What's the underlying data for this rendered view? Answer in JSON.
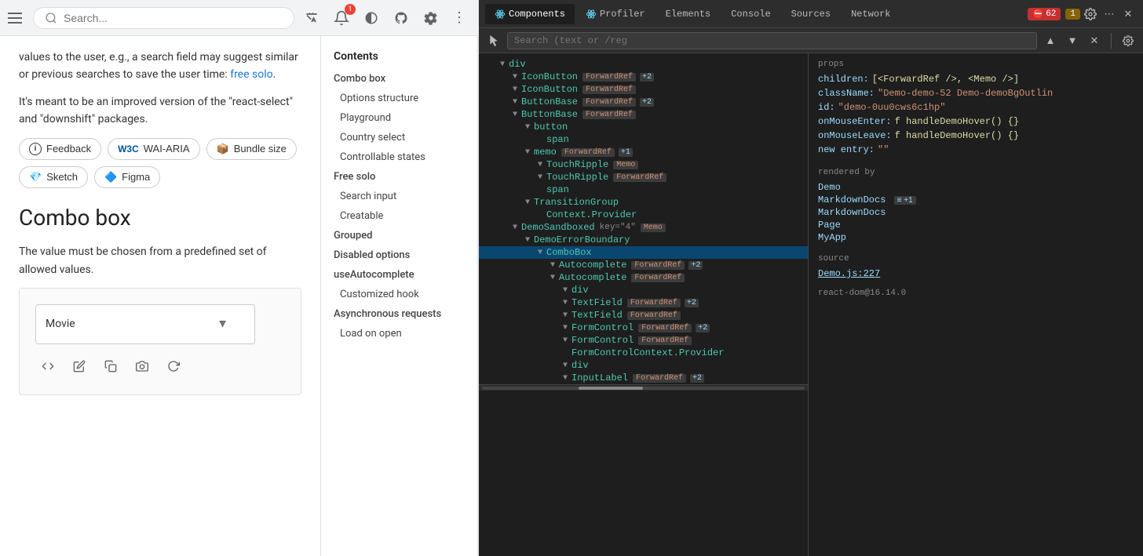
{
  "browser": {
    "search_placeholder": "Search...",
    "menu_icon": "≡",
    "bell_badge": "1"
  },
  "article": {
    "intro_text": "values to the user, e.g., a search field may suggest similar or previous searches to save the user time:",
    "free_solo_link": "free solo",
    "second_para": "It's meant to be an improved version of the \"react-select\" and \"downshift\" packages.",
    "feedback_btn": "Feedback",
    "wai_btn": "WAI-ARIA",
    "bundle_btn": "Bundle size",
    "sketch_btn": "Sketch",
    "figma_btn": "Figma",
    "section_title": "Combo box",
    "section_desc": "The value must be chosen from a predefined set of allowed values.",
    "select_value": "Movie"
  },
  "sidebar": {
    "section_label": "Contents",
    "items": [
      {
        "id": "combo-box",
        "label": "Combo box",
        "indent": false,
        "active": false
      },
      {
        "id": "options-structure",
        "label": "Options structure",
        "indent": true,
        "active": false
      },
      {
        "id": "playground",
        "label": "Playground",
        "indent": true,
        "active": false
      },
      {
        "id": "country-select",
        "label": "Country select",
        "indent": true,
        "active": false
      },
      {
        "id": "controllable-states",
        "label": "Controllable states",
        "indent": true,
        "active": false
      },
      {
        "id": "free-solo",
        "label": "Free solo",
        "indent": false,
        "active": false
      },
      {
        "id": "search-input",
        "label": "Search input",
        "indent": true,
        "active": false
      },
      {
        "id": "creatable",
        "label": "Creatable",
        "indent": true,
        "active": false
      },
      {
        "id": "grouped",
        "label": "Grouped",
        "indent": false,
        "active": false
      },
      {
        "id": "disabled-options",
        "label": "Disabled options",
        "indent": false,
        "active": false
      },
      {
        "id": "useautocomplete",
        "label": "useAutocomplete",
        "indent": false,
        "active": false
      },
      {
        "id": "customized-hook",
        "label": "Customized hook",
        "indent": true,
        "active": false
      },
      {
        "id": "async-requests",
        "label": "Asynchronous requests",
        "indent": false,
        "active": false
      },
      {
        "id": "load-on-open",
        "label": "Load on open",
        "indent": true,
        "active": false
      }
    ]
  },
  "devtools": {
    "tabs": [
      {
        "id": "components",
        "label": "Components",
        "active": true,
        "is_react": true
      },
      {
        "id": "profiler",
        "label": "Profiler",
        "active": false,
        "is_react": true
      },
      {
        "id": "elements",
        "label": "Elements",
        "active": false
      },
      {
        "id": "console",
        "label": "Console",
        "active": false
      },
      {
        "id": "sources",
        "label": "Sources",
        "active": false
      },
      {
        "id": "network",
        "label": "Network",
        "active": false
      }
    ],
    "error_count": "62",
    "warn_count": "1",
    "search_placeholder": "Search (text or /reg",
    "tree": [
      {
        "indent": 1,
        "open": true,
        "tag": "div",
        "badges": []
      },
      {
        "indent": 2,
        "open": true,
        "tag": "IconButton",
        "badges": [
          {
            "text": "ForwardRef",
            "type": "ref"
          },
          {
            "text": "+2",
            "type": "num"
          }
        ]
      },
      {
        "indent": 2,
        "open": true,
        "tag": "IconButton",
        "badges": [
          {
            "text": "ForwardRef",
            "type": "ref"
          }
        ]
      },
      {
        "indent": 2,
        "open": true,
        "tag": "ButtonBase",
        "badges": [
          {
            "text": "ForwardRef",
            "type": "ref"
          },
          {
            "text": "+2",
            "type": "num"
          }
        ]
      },
      {
        "indent": 2,
        "open": true,
        "tag": "ButtonBase",
        "badges": [
          {
            "text": "ForwardRef",
            "type": "ref"
          }
        ]
      },
      {
        "indent": 3,
        "open": true,
        "tag": "button",
        "badges": []
      },
      {
        "indent": 4,
        "open": false,
        "tag": "span",
        "badges": []
      },
      {
        "indent": 3,
        "open": true,
        "tag": "memo",
        "badges": [
          {
            "text": "ForwardRef",
            "type": "ref"
          },
          {
            "text": "+1",
            "type": "num"
          }
        ]
      },
      {
        "indent": 4,
        "open": true,
        "tag": "TouchRipple",
        "badges": [
          {
            "text": "Memo",
            "type": "ref"
          }
        ]
      },
      {
        "indent": 4,
        "open": true,
        "tag": "TouchRipple",
        "badges": [
          {
            "text": "ForwardRef",
            "type": "ref"
          }
        ]
      },
      {
        "indent": 4,
        "open": false,
        "tag": "span",
        "badges": []
      },
      {
        "indent": 3,
        "open": true,
        "tag": "TransitionGroup",
        "badges": []
      },
      {
        "indent": 4,
        "open": false,
        "tag": "Context.Provider",
        "badges": []
      },
      {
        "indent": 2,
        "open": true,
        "tag": "DemoSandboxed",
        "key": "4",
        "badges": [
          {
            "text": "Memo",
            "type": "ref"
          }
        ]
      },
      {
        "indent": 3,
        "open": true,
        "tag": "DemoErrorBoundary",
        "badges": []
      },
      {
        "indent": 4,
        "open": true,
        "tag": "ComboBox",
        "badges": [],
        "selected": true
      },
      {
        "indent": 5,
        "open": true,
        "tag": "Autocomplete",
        "badges": [
          {
            "text": "ForwardRef",
            "type": "ref"
          },
          {
            "text": "+2",
            "type": "num"
          }
        ]
      },
      {
        "indent": 5,
        "open": true,
        "tag": "Autocomplete",
        "badges": [
          {
            "text": "ForwardRef",
            "type": "ref"
          }
        ]
      },
      {
        "indent": 6,
        "open": true,
        "tag": "div",
        "badges": []
      },
      {
        "indent": 6,
        "open": true,
        "tag": "TextField",
        "badges": [
          {
            "text": "ForwardRef",
            "type": "ref"
          },
          {
            "text": "+2",
            "type": "num"
          }
        ]
      },
      {
        "indent": 6,
        "open": true,
        "tag": "TextField",
        "badges": [
          {
            "text": "ForwardRef",
            "type": "ref"
          }
        ]
      },
      {
        "indent": 6,
        "open": true,
        "tag": "FormControl",
        "badges": [
          {
            "text": "ForwardRef",
            "type": "ref"
          },
          {
            "text": "+2",
            "type": "num"
          }
        ]
      },
      {
        "indent": 6,
        "open": true,
        "tag": "FormControl",
        "badges": [
          {
            "text": "ForwardRef",
            "type": "ref"
          }
        ]
      },
      {
        "indent": 6,
        "open": false,
        "tag": "FormControlContext.Provider",
        "badges": []
      },
      {
        "indent": 6,
        "open": true,
        "tag": "div",
        "badges": []
      },
      {
        "indent": 6,
        "open": true,
        "tag": "InputLabel",
        "badges": [
          {
            "text": "ForwardRef",
            "type": "ref"
          },
          {
            "text": "+2",
            "type": "num"
          }
        ]
      }
    ],
    "props": {
      "section": "props",
      "children_val": "[<ForwardRef />, <Memo />]",
      "classname_val": "\"Demo-demo-52 Demo-demoBgOutlin",
      "id_val": "\"demo-0uu0cws6c1hp\"",
      "onmouseenter_val": "f handleDemoHover() {}",
      "onmouseleave_val": "f handleDemoHover() {}",
      "new_entry_key": "new entry:",
      "new_entry_val": "\"\""
    },
    "rendered_by": {
      "section": "rendered by",
      "items": [
        "Demo",
        "MarkdownDocs",
        "MarkdownDocs",
        "Page",
        "MyApp"
      ]
    },
    "source": {
      "section": "source",
      "file": "Demo.js:227"
    }
  }
}
